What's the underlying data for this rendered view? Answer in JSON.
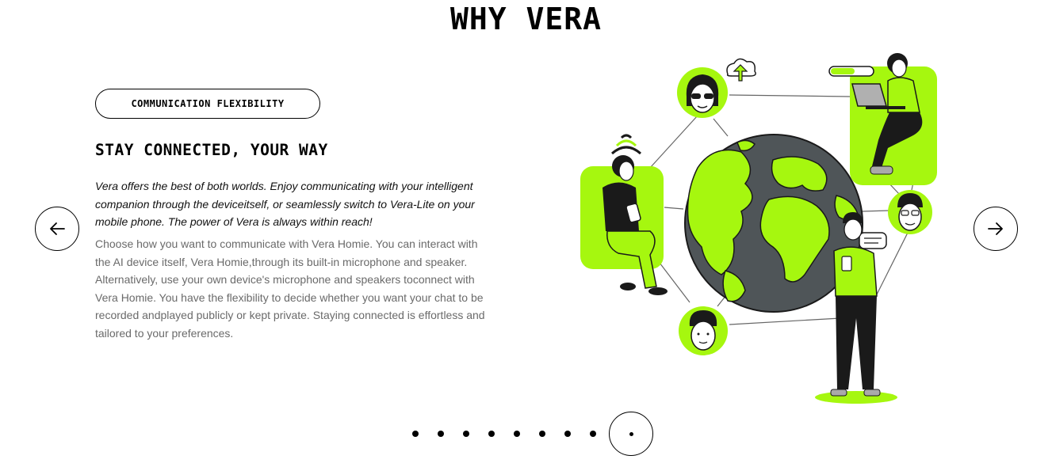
{
  "page": {
    "title": "WHY VERA"
  },
  "slide": {
    "tag": "COMMUNICATION FLEXIBILITY",
    "heading": "STAY CONNECTED, YOUR WAY",
    "lead": "Vera offers the best of both worlds. Enjoy communicating with your intelligent companion through the deviceitself, or seamlessly switch to Vera-Lite on your mobile phone. The power of Vera is always within reach!",
    "body": "Choose how you want to communicate with Vera Homie. You can interact with the AI device itself, Vera Homie,through its built-in microphone and speaker. Alternatively, use your own device's microphone and speakers toconnect with Vera Homie. You have the flexibility to decide whether you want your chat to be recorded andplayed publicly or kept private. Staying connected is effortless and tailored to your preferences."
  },
  "navigation": {
    "prev_icon": "arrow-left-icon",
    "next_icon": "arrow-right-icon"
  },
  "pagination": {
    "total": 9,
    "current": 9
  },
  "colors": {
    "accent": "#a6f70f",
    "globe_dark": "#4f5558",
    "text": "#000000",
    "muted_text": "#6a6a6a"
  }
}
